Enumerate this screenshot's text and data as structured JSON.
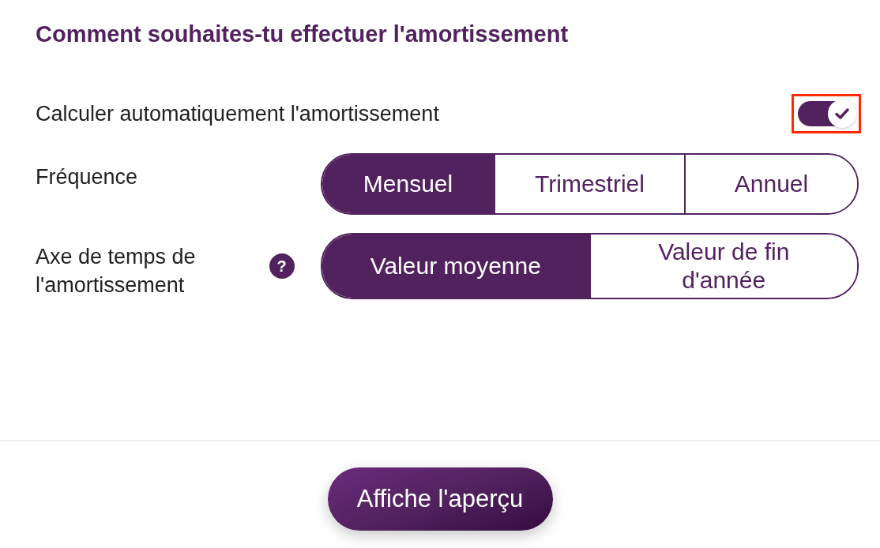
{
  "title": "Comment souhaites-tu effectuer l'amortissement",
  "auto_calc": {
    "label": "Calculer automatiquement l'amortissement",
    "on": true,
    "highlighted": true
  },
  "settings": [
    {
      "label": "Fréquence",
      "options": [
        {
          "label": "Mensuel",
          "selected": true
        },
        {
          "label": "Trimestriel",
          "selected": false
        },
        {
          "label": "Annuel",
          "selected": false
        }
      ]
    },
    {
      "label": "Axe de temps de l'amortissement",
      "help": "?",
      "options": [
        {
          "label": "Valeur moyenne",
          "selected": true
        },
        {
          "label": "Valeur de fin d'année",
          "selected": false
        }
      ]
    }
  ],
  "footer": {
    "button": "Affiche l'aperçu"
  }
}
